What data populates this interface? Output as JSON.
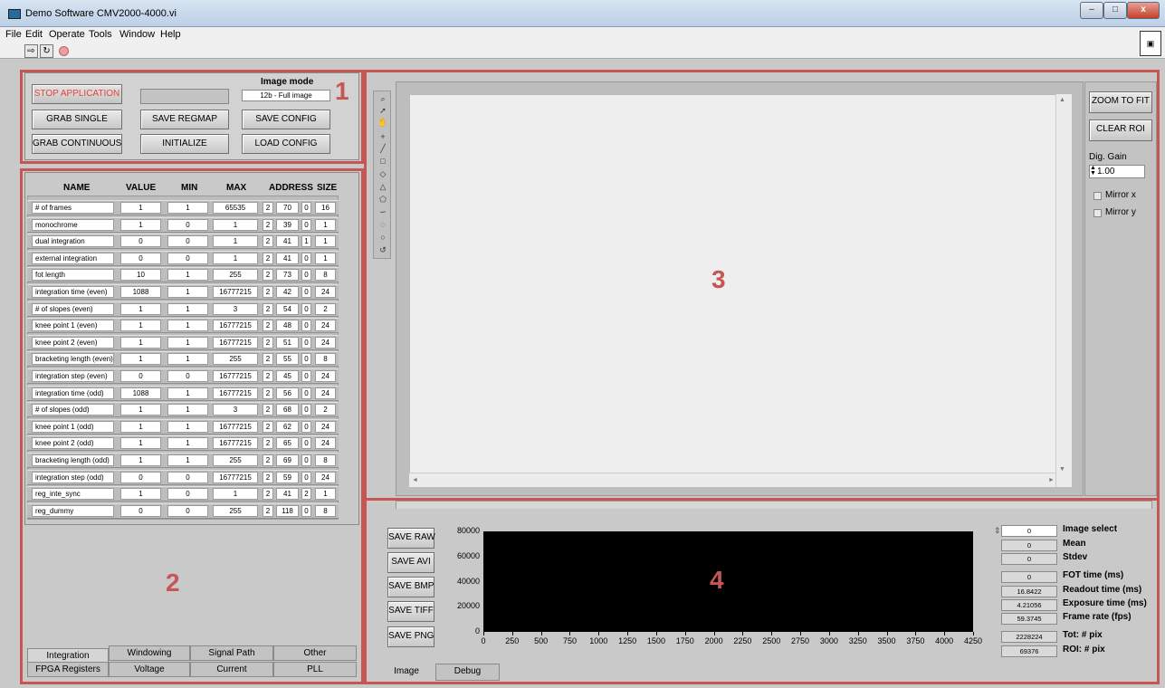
{
  "window": {
    "title": "Demo Software CMV2000-4000.vi",
    "min": "–",
    "max": "□",
    "close": "x"
  },
  "menu": [
    {
      "label": "File"
    },
    {
      "label": "Edit"
    },
    {
      "label": "Operate"
    },
    {
      "label": "Tools"
    },
    {
      "label": "Window"
    },
    {
      "label": "Help"
    }
  ],
  "toolbar": {
    "run": "⇨",
    "run_continuous": "↻"
  },
  "section1": {
    "number": "1",
    "stop_label": "STOP APPLICATION",
    "grab_single": "GRAB SINGLE",
    "grab_continuous": "GRAB CONTINUOUS",
    "save_regmap": "SAVE REGMAP",
    "initialize": "INITIALIZE",
    "image_mode_label": "Image mode",
    "image_mode_value": "12b - Full image",
    "save_config": "SAVE CONFIG",
    "load_config": "LOAD CONFIG"
  },
  "section2": {
    "number": "2",
    "headers": {
      "name": "NAME",
      "value": "VALUE",
      "min": "MIN",
      "max": "MAX",
      "address": "ADDRESS",
      "size": "SIZE"
    },
    "rows": [
      {
        "name": "# of frames",
        "value": "1",
        "min": "1",
        "max": "65535",
        "a1": "2",
        "a2": "70",
        "a3": "0",
        "size": "16"
      },
      {
        "name": "monochrome",
        "value": "1",
        "min": "0",
        "max": "1",
        "a1": "2",
        "a2": "39",
        "a3": "0",
        "size": "1"
      },
      {
        "name": "dual integration",
        "value": "0",
        "min": "0",
        "max": "1",
        "a1": "2",
        "a2": "41",
        "a3": "1",
        "size": "1"
      },
      {
        "name": "external integration",
        "value": "0",
        "min": "0",
        "max": "1",
        "a1": "2",
        "a2": "41",
        "a3": "0",
        "size": "1"
      },
      {
        "name": "fot length",
        "value": "10",
        "min": "1",
        "max": "255",
        "a1": "2",
        "a2": "73",
        "a3": "0",
        "size": "8"
      },
      {
        "name": "integration time (even)",
        "value": "1088",
        "min": "1",
        "max": "16777215",
        "a1": "2",
        "a2": "42",
        "a3": "0",
        "size": "24"
      },
      {
        "name": "# of slopes (even)",
        "value": "1",
        "min": "1",
        "max": "3",
        "a1": "2",
        "a2": "54",
        "a3": "0",
        "size": "2"
      },
      {
        "name": "knee point 1 (even)",
        "value": "1",
        "min": "1",
        "max": "16777215",
        "a1": "2",
        "a2": "48",
        "a3": "0",
        "size": "24"
      },
      {
        "name": "knee point 2 (even)",
        "value": "1",
        "min": "1",
        "max": "16777215",
        "a1": "2",
        "a2": "51",
        "a3": "0",
        "size": "24"
      },
      {
        "name": "bracketing length (even)",
        "value": "1",
        "min": "1",
        "max": "255",
        "a1": "2",
        "a2": "55",
        "a3": "0",
        "size": "8"
      },
      {
        "name": "integration step (even)",
        "value": "0",
        "min": "0",
        "max": "16777215",
        "a1": "2",
        "a2": "45",
        "a3": "0",
        "size": "24"
      },
      {
        "name": "integration time (odd)",
        "value": "1088",
        "min": "1",
        "max": "16777215",
        "a1": "2",
        "a2": "56",
        "a3": "0",
        "size": "24"
      },
      {
        "name": "# of slopes (odd)",
        "value": "1",
        "min": "1",
        "max": "3",
        "a1": "2",
        "a2": "68",
        "a3": "0",
        "size": "2"
      },
      {
        "name": "knee point 1 (odd)",
        "value": "1",
        "min": "1",
        "max": "16777215",
        "a1": "2",
        "a2": "62",
        "a3": "0",
        "size": "24"
      },
      {
        "name": "knee point 2 (odd)",
        "value": "1",
        "min": "1",
        "max": "16777215",
        "a1": "2",
        "a2": "65",
        "a3": "0",
        "size": "24"
      },
      {
        "name": "bracketing length (odd)",
        "value": "1",
        "min": "1",
        "max": "255",
        "a1": "2",
        "a2": "69",
        "a3": "0",
        "size": "8"
      },
      {
        "name": "integration step (odd)",
        "value": "0",
        "min": "0",
        "max": "16777215",
        "a1": "2",
        "a2": "59",
        "a3": "0",
        "size": "24"
      },
      {
        "name": "reg_inte_sync",
        "value": "1",
        "min": "0",
        "max": "1",
        "a1": "2",
        "a2": "41",
        "a3": "2",
        "size": "1"
      },
      {
        "name": "reg_dummy",
        "value": "0",
        "min": "0",
        "max": "255",
        "a1": "2",
        "a2": "118",
        "a3": "0",
        "size": "8"
      }
    ],
    "tabs_top": [
      "Integration",
      "Windowing",
      "Signal Path",
      "Other"
    ],
    "tabs_bottom": [
      "FPGA Registers",
      "Voltage",
      "Current",
      "PLL"
    ]
  },
  "section3": {
    "number": "3",
    "zoom_to_fit": "ZOOM TO FIT",
    "clear_roi": "CLEAR ROI",
    "dig_gain_label": "Dig. Gain",
    "dig_gain_value": "1.00",
    "mirror_x": "Mirror x",
    "mirror_y": "Mirror y"
  },
  "section4": {
    "number": "4",
    "save_raw": "SAVE RAW",
    "save_avi": "SAVE AVI",
    "save_bmp": "SAVE BMP",
    "save_tiff": "SAVE TIFF",
    "save_png": "SAVE PNG",
    "tab_image": "Image",
    "tab_debug": "Debug",
    "stats": [
      {
        "value": "0",
        "label": "Image select"
      },
      {
        "value": "0",
        "label": "Mean"
      },
      {
        "value": "0",
        "label": "Stdev"
      },
      {
        "value": "0",
        "label": "FOT time (ms)"
      },
      {
        "value": "16.8422",
        "label": "Readout time (ms)"
      },
      {
        "value": "4.21056",
        "label": "Exposure time (ms)"
      },
      {
        "value": "59.3745",
        "label": "Frame rate (fps)"
      },
      {
        "value": "2228224",
        "label": "Tot: # pix"
      },
      {
        "value": "69376",
        "label": "ROI: # pix"
      }
    ]
  },
  "chart_data": {
    "type": "line",
    "title": "",
    "xlabel": "",
    "ylabel": "",
    "xlim": [
      0,
      4250
    ],
    "ylim": [
      0,
      80000
    ],
    "x_ticks": [
      "0",
      "250",
      "500",
      "750",
      "1000",
      "1250",
      "1500",
      "1750",
      "2000",
      "2250",
      "2500",
      "2750",
      "3000",
      "3250",
      "3500",
      "3750",
      "4000",
      "4250"
    ],
    "y_ticks": [
      "80000",
      "60000",
      "40000",
      "20000",
      "0"
    ],
    "series": [],
    "background": "#000000"
  }
}
